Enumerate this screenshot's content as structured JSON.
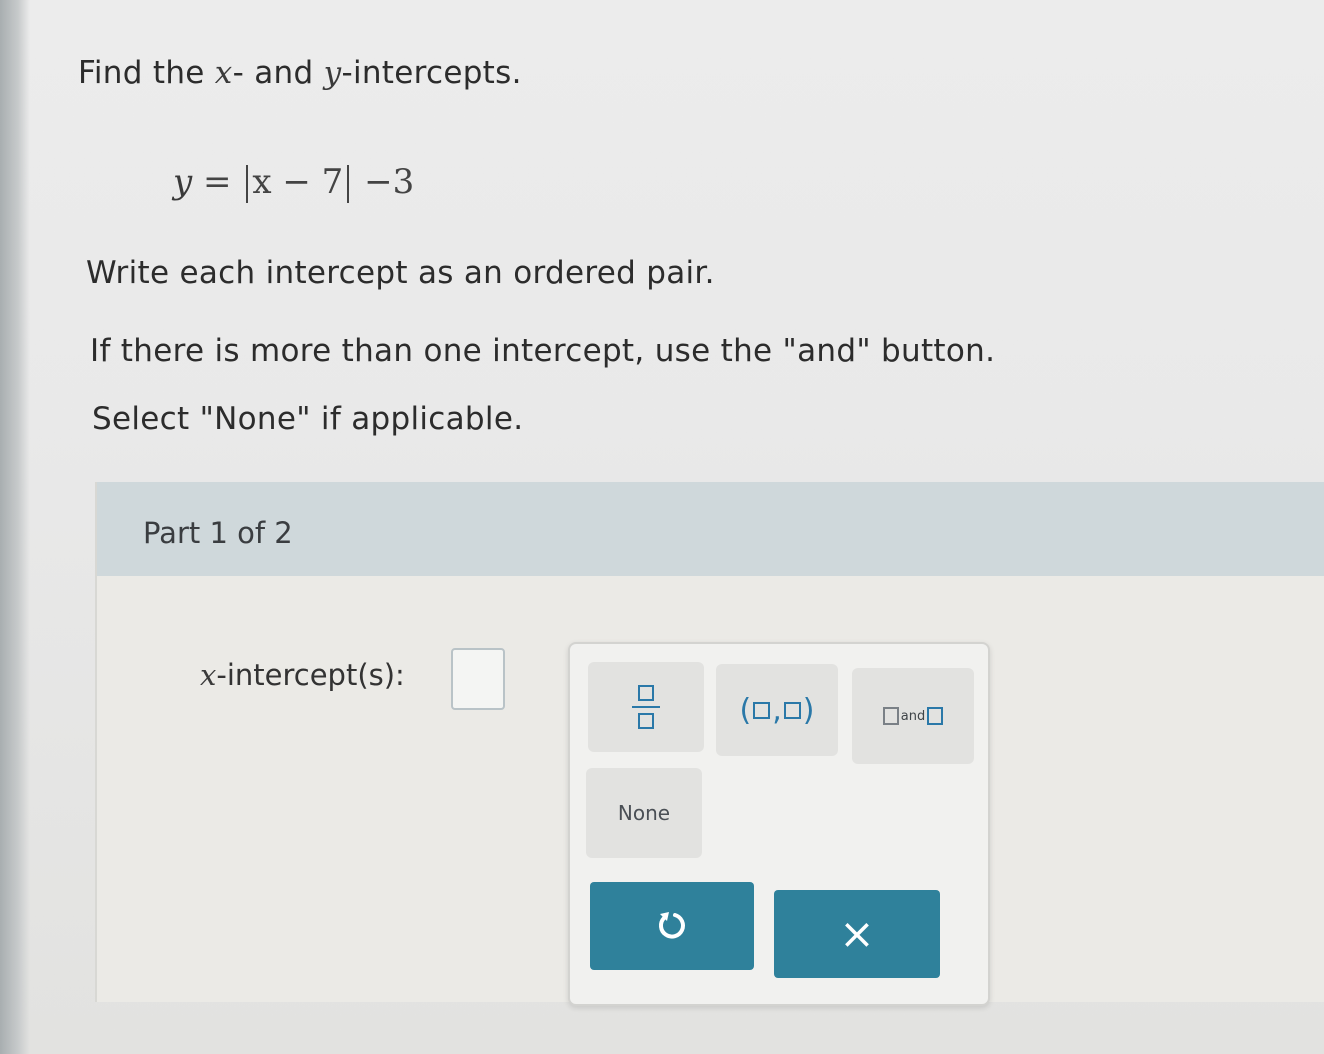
{
  "question": {
    "line1_prefix": "Find the ",
    "line1_var_x": "x",
    "line1_middle": "- and ",
    "line1_var_y": "y",
    "line1_suffix": "-intercepts.",
    "equation": {
      "lhs": "y",
      "equals": "=",
      "inner": "x − 7",
      "rest": "−3"
    },
    "instruction1": "Write each intercept as an ordered pair.",
    "instruction2": "If there is more than one intercept, use the \"and\" button.",
    "instruction3": "Select \"None\" if applicable."
  },
  "part": {
    "label": "Part 1 of 2"
  },
  "answer": {
    "label_var": "x",
    "label_text": "-intercept(s):",
    "value": ""
  },
  "keypad": {
    "pair_open": "(",
    "pair_comma": ",",
    "pair_close": ")",
    "and_label": "and",
    "none_label": "None",
    "clear_symbol": "×"
  },
  "colors": {
    "accent": "#2f819b",
    "placeholder_blue": "#2a78a8",
    "header_band": "#cfd8db"
  },
  "icons": {
    "undo": "undo-icon",
    "clear": "close-icon"
  }
}
